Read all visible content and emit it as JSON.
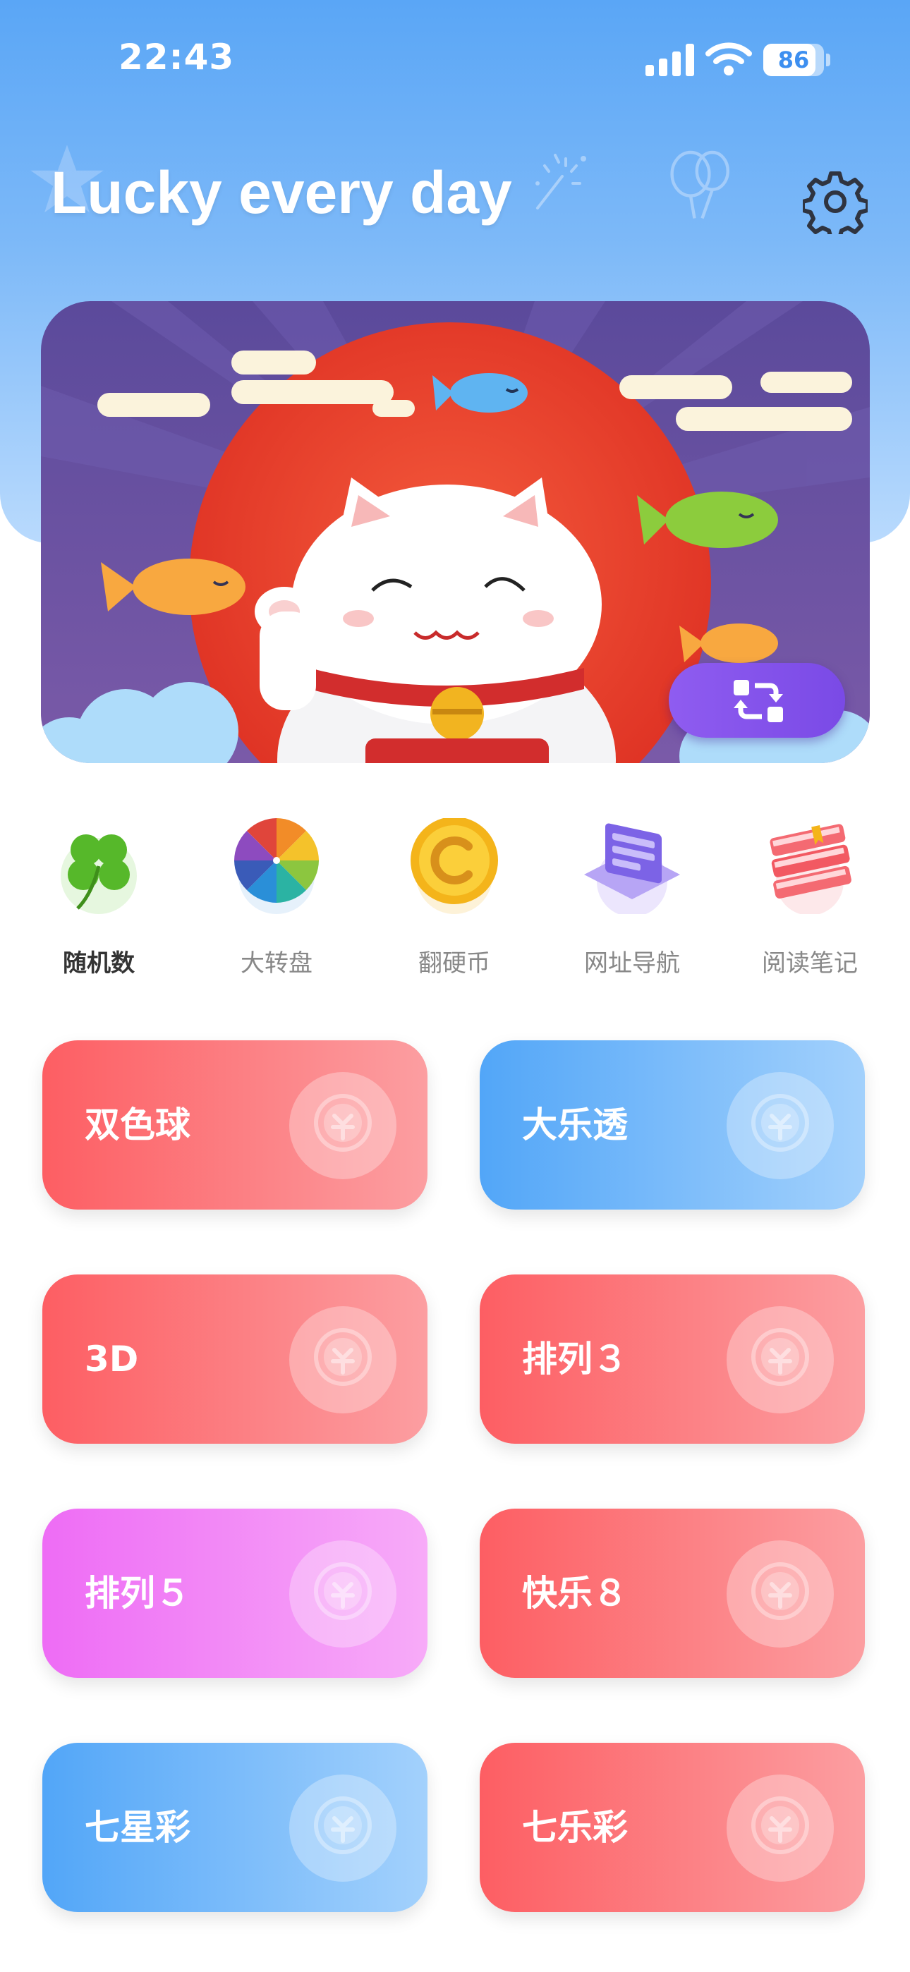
{
  "status_bar": {
    "time": "22:43",
    "battery": "86",
    "battery_level": 0.86
  },
  "header": {
    "title": "Lucky every day"
  },
  "tools": [
    {
      "label": "随机数",
      "icon": "clover-icon",
      "active": true
    },
    {
      "label": "大转盘",
      "icon": "wheel-icon",
      "active": false
    },
    {
      "label": "翻硬币",
      "icon": "coin-icon",
      "active": false
    },
    {
      "label": "网址导航",
      "icon": "browser-icon",
      "active": false
    },
    {
      "label": "阅读笔记",
      "icon": "books-icon",
      "active": false
    }
  ],
  "lotteries": [
    {
      "name": "双色球",
      "color": "red"
    },
    {
      "name": "大乐透",
      "color": "blue"
    },
    {
      "name": "3D",
      "color": "red"
    },
    {
      "name": "排列３",
      "color": "red"
    },
    {
      "name": "排列５",
      "color": "pink"
    },
    {
      "name": "快乐８",
      "color": "red"
    },
    {
      "name": "七星彩",
      "color": "blue"
    },
    {
      "name": "七乐彩",
      "color": "red"
    }
  ],
  "colors": {
    "header_top": "#5aa6f6",
    "red_card": "#fd5e63",
    "blue_card": "#52a6f8",
    "pink_card": "#ee6cf5",
    "swap_button": "#8f5cf0"
  }
}
